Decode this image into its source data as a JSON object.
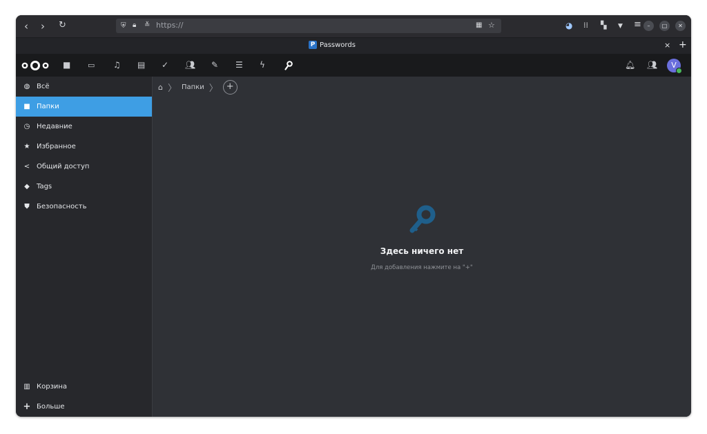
{
  "browser": {
    "url": "https://",
    "tab_title": "Passwords",
    "tab_favicon": "P",
    "nav_icons": [
      "back-icon",
      "forward-icon",
      "reload-icon"
    ],
    "close_tab": "×",
    "new_tab": "+"
  },
  "header": {
    "user_initial": "V",
    "app_icons": [
      "files-icon",
      "photos-icon",
      "music-icon",
      "calendar-icon",
      "tasks-icon",
      "contacts-icon",
      "notes-icon",
      "deck-icon",
      "activity-icon",
      "passwords-icon"
    ]
  },
  "sidebar": {
    "items": [
      {
        "label": "Всё",
        "icon": "globe-icon"
      },
      {
        "label": "Папки",
        "icon": "folder-icon"
      },
      {
        "label": "Недавние",
        "icon": "clock-icon"
      },
      {
        "label": "Избранное",
        "icon": "star-icon"
      },
      {
        "label": "Общий доступ",
        "icon": "share-icon"
      },
      {
        "label": "Tags",
        "icon": "tag-icon"
      },
      {
        "label": "Безопасность",
        "icon": "shield-icon"
      }
    ],
    "bottom": [
      {
        "label": "Корзина",
        "icon": "trash-icon"
      },
      {
        "label": "Больше",
        "icon": "plus-icon"
      }
    ]
  },
  "breadcrumb": {
    "current": "Папки"
  },
  "empty_state": {
    "title": "Здесь ничего нет",
    "description": "Для добавления нажмите на \"+\""
  },
  "colors": {
    "accent": "#3e9ee4",
    "key_icon": "#1f5f8b",
    "background": "#2f3136"
  }
}
